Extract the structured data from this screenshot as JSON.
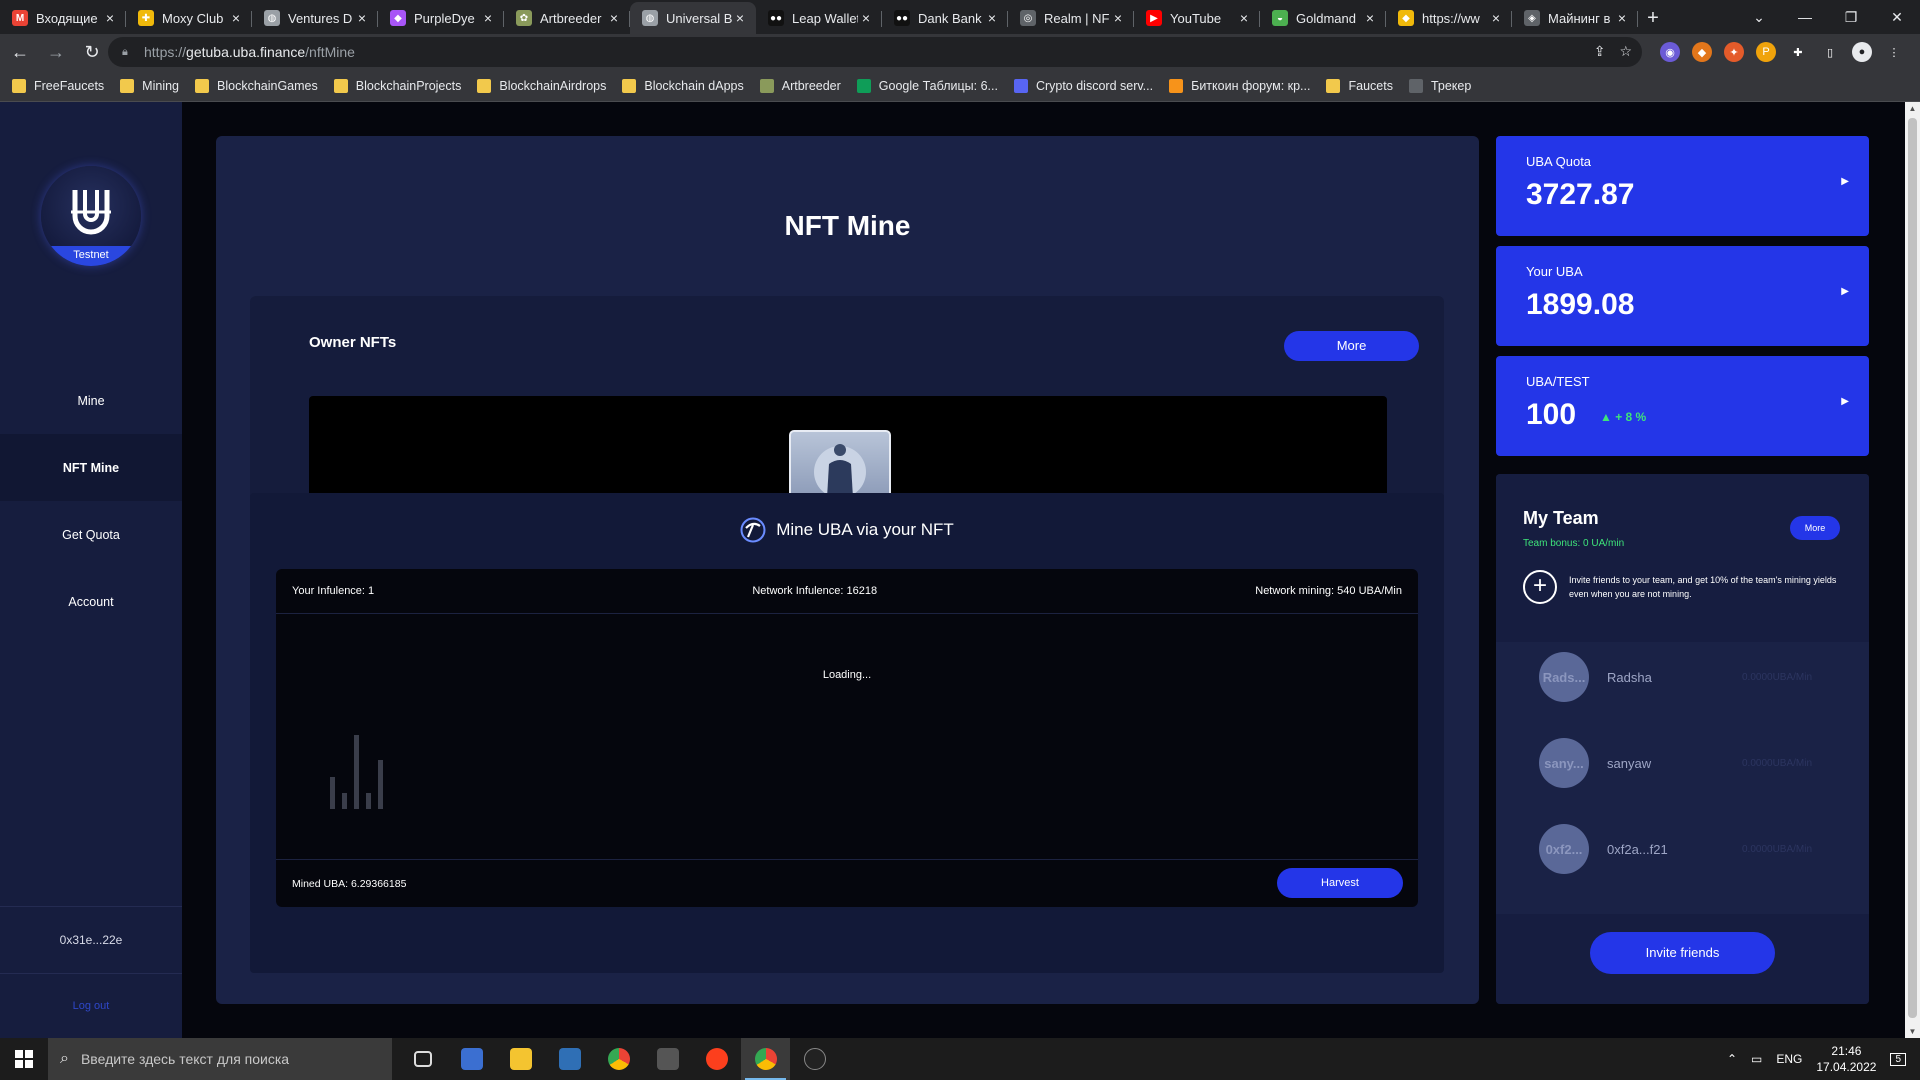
{
  "browser": {
    "tabs": [
      {
        "label": "Входящие (",
        "color": "#ea4335",
        "glyph": "M"
      },
      {
        "label": "Moxy Club",
        "color": "#f0b90b",
        "glyph": "✚"
      },
      {
        "label": "Ventures D",
        "color": "#9aa0a6",
        "glyph": "◍"
      },
      {
        "label": "PurpleDye",
        "color": "#a855f7",
        "glyph": "◆"
      },
      {
        "label": "Artbreeder",
        "color": "#8a9a5b",
        "glyph": "✿"
      },
      {
        "label": "Universal B",
        "color": "#9aa0a6",
        "glyph": "◍",
        "active": true
      },
      {
        "label": "Leap Wallet",
        "color": "#111111",
        "glyph": "●●"
      },
      {
        "label": "Dank Bank",
        "color": "#111111",
        "glyph": "●●"
      },
      {
        "label": "Realm | NF",
        "color": "#5f6368",
        "glyph": "◎"
      },
      {
        "label": "YouTube",
        "color": "#ff0000",
        "glyph": "▶"
      },
      {
        "label": "Goldmand",
        "color": "#4caf50",
        "glyph": "◒"
      },
      {
        "label": "https://ww",
        "color": "#f0b90b",
        "glyph": "◆"
      },
      {
        "label": "Майнинг в",
        "color": "#5f6368",
        "glyph": "◈"
      }
    ],
    "url_scheme": "https://",
    "url_host": "getuba.uba.finance",
    "url_path": "/nftMine",
    "bookmarks": [
      {
        "label": "FreeFaucets",
        "color": "#f2c94c"
      },
      {
        "label": "Mining",
        "color": "#f2c94c"
      },
      {
        "label": "BlockchainGames",
        "color": "#f2c94c"
      },
      {
        "label": "BlockchainProjects",
        "color": "#f2c94c"
      },
      {
        "label": "BlockchainAirdrops",
        "color": "#f2c94c"
      },
      {
        "label": "Blockchain dApps",
        "color": "#f2c94c"
      },
      {
        "label": "Artbreeder",
        "color": "#8a9a5b"
      },
      {
        "label": "Google Таблицы: 6...",
        "color": "#0f9d58"
      },
      {
        "label": "Crypto discord serv...",
        "color": "#5865f2"
      },
      {
        "label": "Биткоин форум: кр...",
        "color": "#f7931a"
      },
      {
        "label": "Faucets",
        "color": "#f2c94c"
      },
      {
        "label": "Трекер",
        "color": "#5f6368"
      }
    ]
  },
  "sidebar": {
    "logo_badge": "Testnet",
    "items": [
      {
        "label": "Mine",
        "active": false
      },
      {
        "label": "NFT Mine",
        "active": true
      },
      {
        "label": "Get Quota",
        "active": false
      },
      {
        "label": "Account",
        "active": false
      }
    ],
    "address": "0x31e...22e",
    "logout": "Log out"
  },
  "main": {
    "title": "NFT Mine",
    "owner": {
      "title": "Owner NFTs",
      "more": "More"
    },
    "mine": {
      "title": "Mine UBA via your NFT",
      "influence": "Your Infulence: 1",
      "network_influence": "Network Infulence: 16218",
      "network_mining": "Network mining: 540 UBA/Min",
      "loading": "Loading...",
      "mined": "Mined UBA: 6.29366185",
      "harvest": "Harvest",
      "activity_bars": [
        0.35,
        0.17,
        0.8,
        0.17,
        0.53
      ]
    }
  },
  "stats": {
    "quota": {
      "label": "UBA Quota",
      "value": "3727.87"
    },
    "your_uba": {
      "label": "Your UBA",
      "value": "1899.08"
    },
    "price": {
      "label": "UBA/TEST",
      "value": "100",
      "change": "▲ + 8 %"
    }
  },
  "team": {
    "title": "My Team",
    "bonus": "Team bonus: 0 UA/min",
    "more": "More",
    "invite_text": "Invite friends to your team, and get 10% of the team's mining yields even when you are not mining.",
    "members": [
      {
        "avatar": "Rads...",
        "name": "Radsha",
        "rate": "0.0000UBA/Min"
      },
      {
        "avatar": "sany...",
        "name": "sanyaw",
        "rate": "0.0000UBA/Min"
      },
      {
        "avatar": "0xf2...",
        "name": "0xf2a...f21",
        "rate": "0.0000UBA/Min"
      }
    ],
    "invite_button": "Invite friends"
  },
  "taskbar": {
    "search_placeholder": "Введите здесь текст для поиска",
    "lang": "ENG",
    "time": "21:46",
    "date": "17.04.2022",
    "notifications": "5"
  },
  "colors": {
    "accent": "#2436e8",
    "positive": "#3ee37a",
    "panel": "#1a2246",
    "sidebar": "#161d3e"
  }
}
